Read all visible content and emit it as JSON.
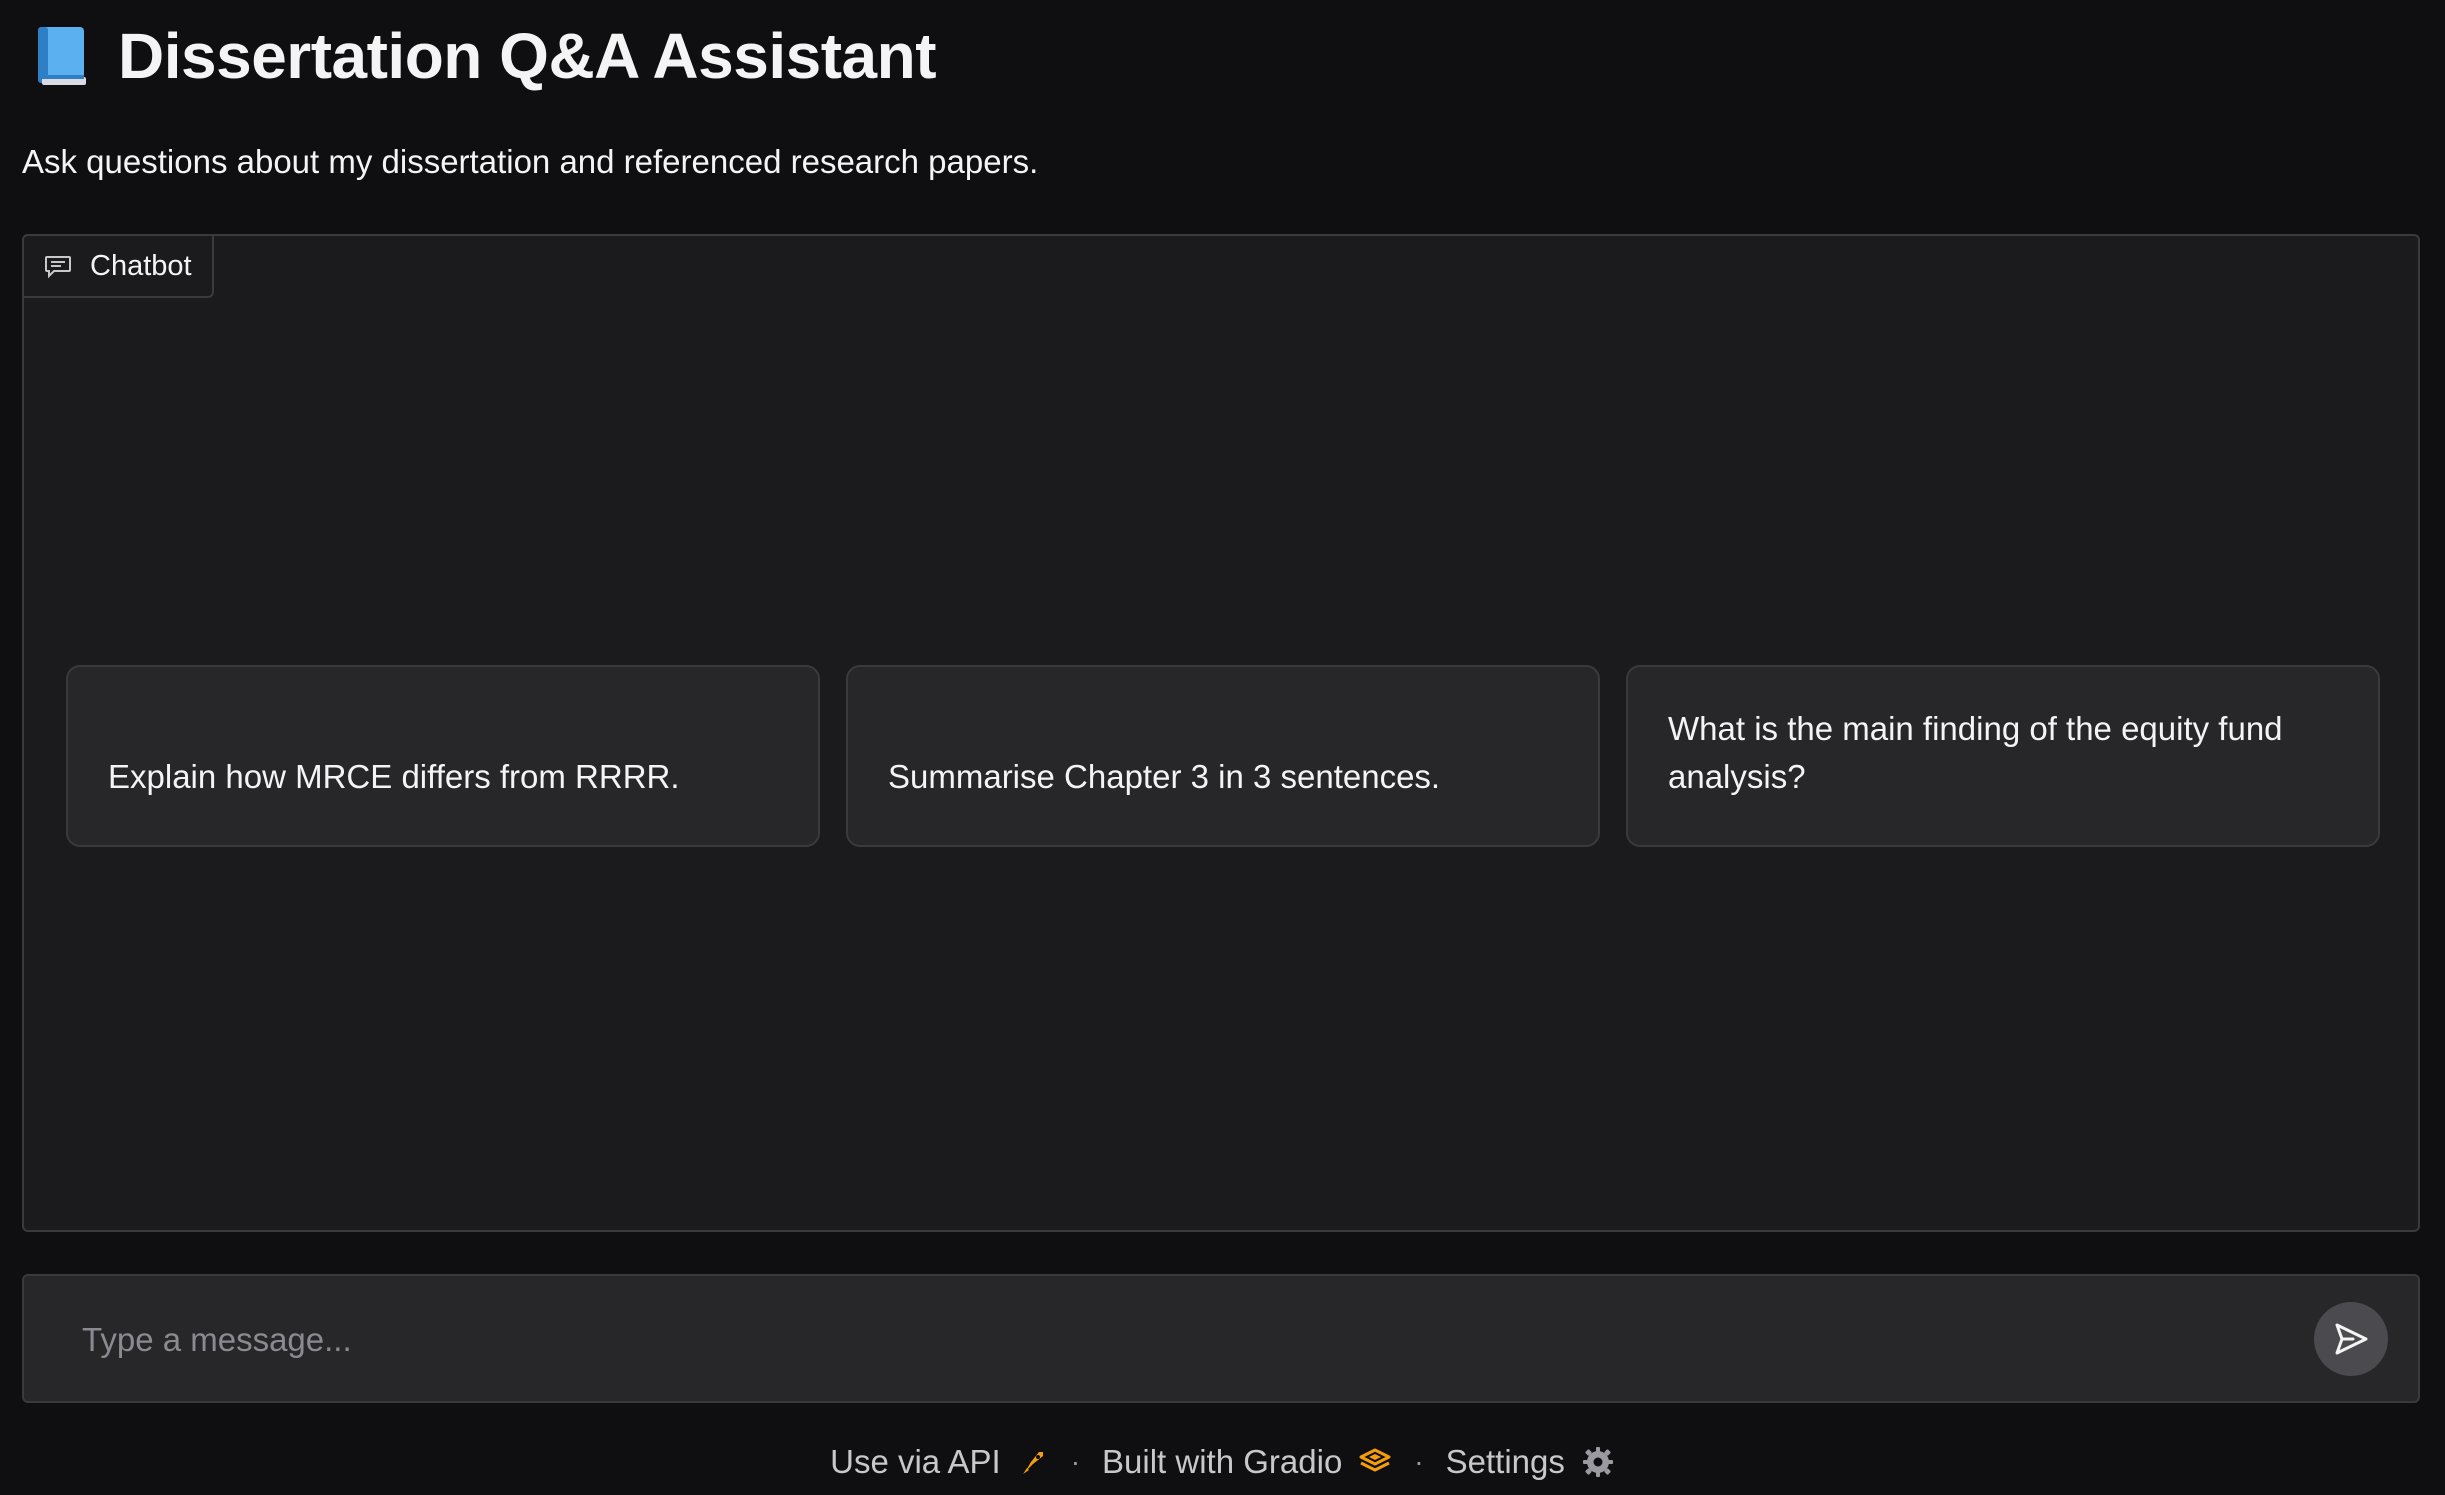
{
  "header": {
    "title": "Dissertation Q&A Assistant",
    "icon": "blue-book-icon"
  },
  "subtitle": "Ask questions about my dissertation and referenced research papers.",
  "chatbot": {
    "label": "Chatbot",
    "examples": [
      "Explain how MRCE differs from RRRR.",
      "Summarise Chapter 3 in 3 sentences.",
      "What is the main finding of the equity fund analysis?"
    ]
  },
  "input": {
    "placeholder": "Type a message...",
    "value": ""
  },
  "footer": {
    "api_label": "Use via API",
    "gradio_label": "Built with Gradio",
    "settings_label": "Settings",
    "separator": "·"
  },
  "colors": {
    "background": "#0f0f11",
    "panel": "#1b1b1d",
    "card": "#27272a",
    "border": "#3a3a3d",
    "accent_orange": "#f59e0b",
    "book_blue": "#4aa3e8"
  }
}
